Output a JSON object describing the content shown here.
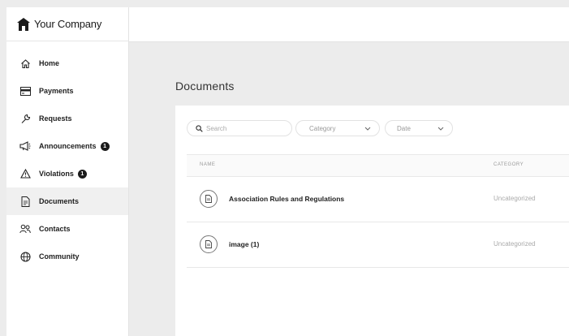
{
  "brand": {
    "name": "Your Company",
    "icon": "house-icon"
  },
  "sidebar": {
    "items": [
      {
        "label": "Home",
        "icon": "home-icon",
        "badge": null
      },
      {
        "label": "Payments",
        "icon": "credit-card-icon",
        "badge": null
      },
      {
        "label": "Requests",
        "icon": "wrench-icon",
        "badge": null
      },
      {
        "label": "Announcements",
        "icon": "megaphone-icon",
        "badge": "1"
      },
      {
        "label": "Violations",
        "icon": "warning-icon",
        "badge": "1"
      },
      {
        "label": "Documents",
        "icon": "document-icon",
        "badge": null,
        "active": true
      },
      {
        "label": "Contacts",
        "icon": "people-icon",
        "badge": null
      },
      {
        "label": "Community",
        "icon": "globe-icon",
        "badge": null
      }
    ]
  },
  "main": {
    "title": "Documents",
    "search": {
      "placeholder": "Search",
      "value": ""
    },
    "filters": {
      "category_label": "Category",
      "date_label": "Date"
    },
    "table": {
      "columns": [
        "NAME",
        "CATEGORY"
      ],
      "rows": [
        {
          "name": "Association Rules and Regulations",
          "category": "Uncategorized"
        },
        {
          "name": "image (1)",
          "category": "Uncategorized"
        }
      ]
    }
  },
  "colors": {
    "active_bg": "#f0f0f0",
    "badge_bg": "#1b1b1b",
    "page_bg": "#ececec"
  }
}
